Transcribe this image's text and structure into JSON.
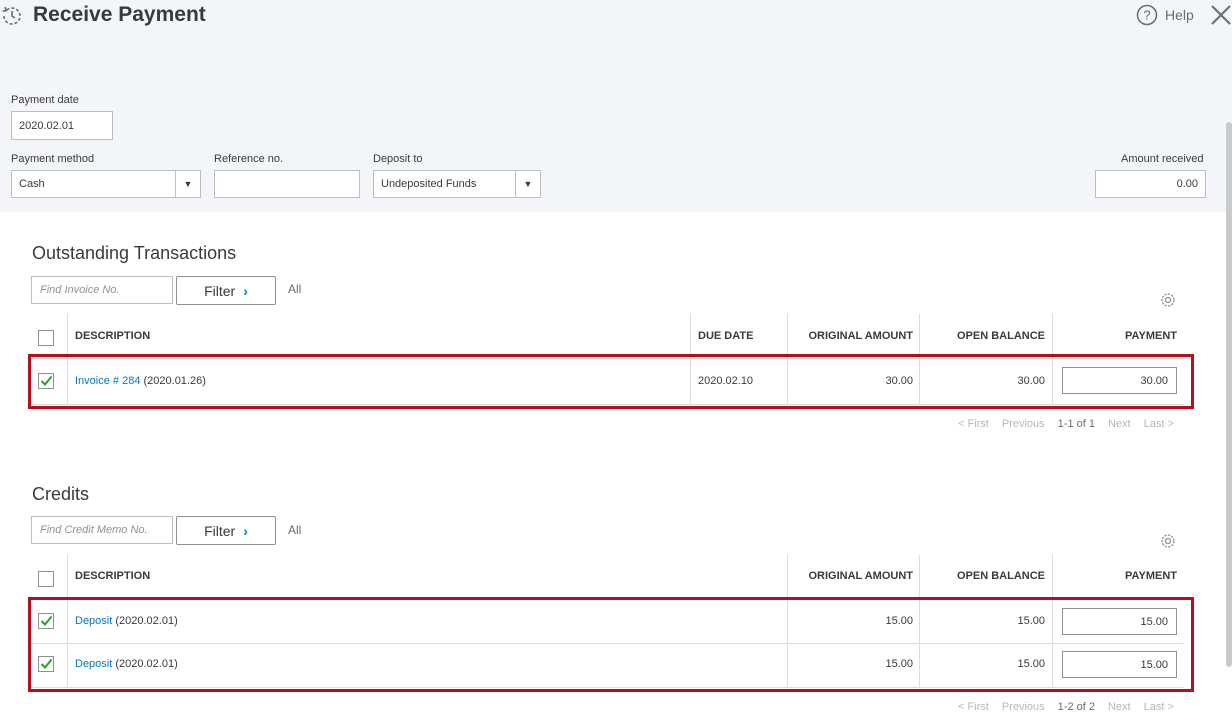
{
  "header": {
    "title": "Receive Payment",
    "help_label": "Help"
  },
  "form": {
    "payment_date_label": "Payment date",
    "payment_date_value": "2020.02.01",
    "payment_method_label": "Payment method",
    "payment_method_value": "Cash",
    "reference_label": "Reference no.",
    "reference_value": "",
    "deposit_to_label": "Deposit to",
    "deposit_to_value": "Undeposited Funds",
    "amount_received_label": "Amount received",
    "amount_received_value": "0.00"
  },
  "outstanding": {
    "title": "Outstanding Transactions",
    "search_placeholder": "Find Invoice No.",
    "filter_label": "Filter",
    "all_label": "All",
    "columns": {
      "description": "DESCRIPTION",
      "due_date": "DUE DATE",
      "original_amount": "ORIGINAL AMOUNT",
      "open_balance": "OPEN BALANCE",
      "payment": "PAYMENT"
    },
    "rows": [
      {
        "checked": true,
        "link": "Invoice # 284",
        "date": "(2020.01.26)",
        "due_date": "2020.02.10",
        "original_amount": "30.00",
        "open_balance": "30.00",
        "payment": "30.00"
      }
    ],
    "pager": {
      "first": "< First",
      "previous": "Previous",
      "range": "1-1 of 1",
      "next": "Next",
      "last": "Last >"
    }
  },
  "credits": {
    "title": "Credits",
    "search_placeholder": "Find Credit Memo No.",
    "filter_label": "Filter",
    "all_label": "All",
    "columns": {
      "description": "DESCRIPTION",
      "original_amount": "ORIGINAL AMOUNT",
      "open_balance": "OPEN BALANCE",
      "payment": "PAYMENT"
    },
    "rows": [
      {
        "checked": true,
        "link": "Deposit",
        "date": "(2020.02.01)",
        "original_amount": "15.00",
        "open_balance": "15.00",
        "payment": "15.00"
      },
      {
        "checked": true,
        "link": "Deposit",
        "date": "(2020.02.01)",
        "original_amount": "15.00",
        "open_balance": "15.00",
        "payment": "15.00"
      }
    ],
    "pager": {
      "first": "< First",
      "previous": "Previous",
      "range": "1-2 of 2",
      "next": "Next",
      "last": "Last >"
    }
  },
  "colors": {
    "link": "#0077c5",
    "check": "#2ca01c",
    "highlight": "#b30f1c",
    "top_band": "#f4f5f8"
  }
}
